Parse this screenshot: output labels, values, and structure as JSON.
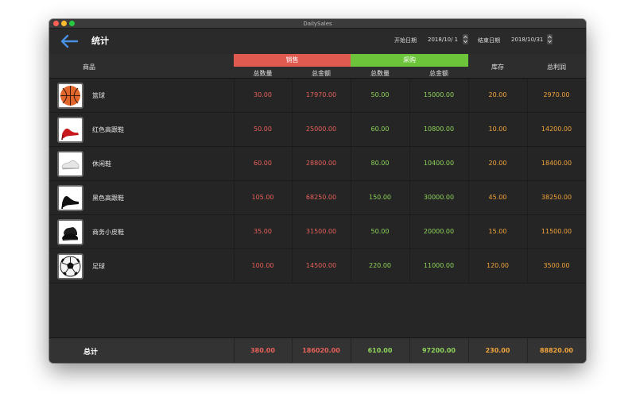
{
  "window": {
    "title": "DailySales"
  },
  "toolbar": {
    "title": "统计",
    "start_label": "开始日期",
    "start_value": "2018/10/ 1",
    "end_label": "结束日期",
    "end_value": "2018/10/31"
  },
  "header": {
    "product": "商品",
    "sales": "销售",
    "purchase": "采购",
    "qty": "总数量",
    "amount": "总金额",
    "stock": "库存",
    "profit": "总利润"
  },
  "colors": {
    "sales": "#e05a50",
    "purchase": "#6cc43a",
    "stock_profit": "#f2a53b"
  },
  "rows": [
    {
      "icon": "basketball-icon",
      "name": "篮球",
      "sales_qty": "30.00",
      "sales_amount": "17970.00",
      "purchase_qty": "50.00",
      "purchase_amount": "15000.00",
      "stock": "20.00",
      "profit": "2970.00"
    },
    {
      "icon": "red-high-heel-icon",
      "name": "红色高跟鞋",
      "sales_qty": "50.00",
      "sales_amount": "25000.00",
      "purchase_qty": "60.00",
      "purchase_amount": "10800.00",
      "stock": "10.00",
      "profit": "14200.00"
    },
    {
      "icon": "casual-shoe-icon",
      "name": "休闲鞋",
      "sales_qty": "60.00",
      "sales_amount": "28800.00",
      "purchase_qty": "80.00",
      "purchase_amount": "10400.00",
      "stock": "20.00",
      "profit": "18400.00"
    },
    {
      "icon": "black-high-heel-icon",
      "name": "黑色高跟鞋",
      "sales_qty": "105.00",
      "sales_amount": "68250.00",
      "purchase_qty": "150.00",
      "purchase_amount": "30000.00",
      "stock": "45.00",
      "profit": "38250.00"
    },
    {
      "icon": "leather-shoe-icon",
      "name": "商务小皮鞋",
      "sales_qty": "35.00",
      "sales_amount": "31500.00",
      "purchase_qty": "50.00",
      "purchase_amount": "20000.00",
      "stock": "15.00",
      "profit": "11500.00"
    },
    {
      "icon": "soccer-ball-icon",
      "name": "足球",
      "sales_qty": "100.00",
      "sales_amount": "14500.00",
      "purchase_qty": "220.00",
      "purchase_amount": "11000.00",
      "stock": "120.00",
      "profit": "3500.00"
    }
  ],
  "totals": {
    "label": "总计",
    "sales_qty": "380.00",
    "sales_amount": "186020.00",
    "purchase_qty": "610.00",
    "purchase_amount": "97200.00",
    "stock": "230.00",
    "profit": "88820.00"
  }
}
